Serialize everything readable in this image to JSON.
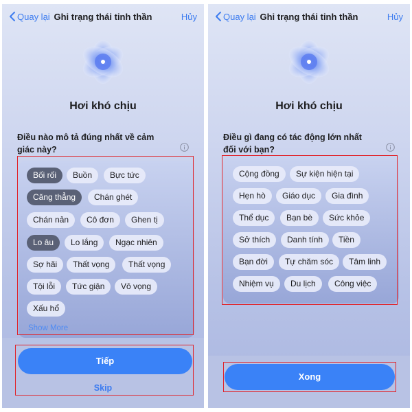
{
  "colors": {
    "accent": "#3a82f7",
    "link": "#3d7cf0",
    "highlight_box": "#e0242b",
    "chip_selected": "#5a6176",
    "chip_default": "#e8ecfa"
  },
  "screens": [
    {
      "nav": {
        "back_label": "Quay lại",
        "title": "Ghi trạng thái tinh thần",
        "cancel_label": "Hủy"
      },
      "heading": "Hơi khó chịu",
      "question": "Điều nào mô tả đúng nhất về cảm giác này?",
      "chips": [
        {
          "label": "Bối rối",
          "selected": true
        },
        {
          "label": "Buồn",
          "selected": false
        },
        {
          "label": "Bực tức",
          "selected": false
        },
        {
          "label": "Căng thẳng",
          "selected": true
        },
        {
          "label": "Chán ghét",
          "selected": false
        },
        {
          "label": "Chán nản",
          "selected": false
        },
        {
          "label": "Cô đơn",
          "selected": false
        },
        {
          "label": "Ghen tị",
          "selected": false
        },
        {
          "label": "Lo âu",
          "selected": true
        },
        {
          "label": "Lo lắng",
          "selected": false
        },
        {
          "label": "Ngạc nhiên",
          "selected": false
        },
        {
          "label": "Sợ hãi",
          "selected": false
        },
        {
          "label": "Thất vọng",
          "selected": false
        },
        {
          "label": "Thất vọng",
          "selected": false
        },
        {
          "label": "Tội lỗi",
          "selected": false
        },
        {
          "label": "Tức giận",
          "selected": false
        },
        {
          "label": "Vô vọng",
          "selected": false
        },
        {
          "label": "Xấu hổ",
          "selected": false
        }
      ],
      "show_more_label": "Show More",
      "primary_label": "Tiếp",
      "skip_label": "Skip"
    },
    {
      "nav": {
        "back_label": "Quay lại",
        "title": "Ghi trạng thái tinh thần",
        "cancel_label": "Hủy"
      },
      "heading": "Hơi khó chịu",
      "question": "Điều gì đang có tác động lớn nhất đối với bạn?",
      "chips": [
        {
          "label": "Cộng đồng",
          "selected": false
        },
        {
          "label": "Sự kiện hiện tại",
          "selected": false
        },
        {
          "label": "Hẹn hò",
          "selected": false
        },
        {
          "label": "Giáo dục",
          "selected": false
        },
        {
          "label": "Gia đình",
          "selected": false
        },
        {
          "label": "Thể dục",
          "selected": false
        },
        {
          "label": "Bạn bè",
          "selected": false
        },
        {
          "label": "Sức khỏe",
          "selected": false
        },
        {
          "label": "Sở thích",
          "selected": false
        },
        {
          "label": "Danh tính",
          "selected": false
        },
        {
          "label": "Tiền",
          "selected": false
        },
        {
          "label": "Bạn đời",
          "selected": false
        },
        {
          "label": "Tự chăm sóc",
          "selected": false
        },
        {
          "label": "Tâm linh",
          "selected": false
        },
        {
          "label": "Nhiệm vụ",
          "selected": false
        },
        {
          "label": "Du lịch",
          "selected": false
        },
        {
          "label": "Công việc",
          "selected": false
        }
      ],
      "primary_label": "Xong"
    }
  ]
}
